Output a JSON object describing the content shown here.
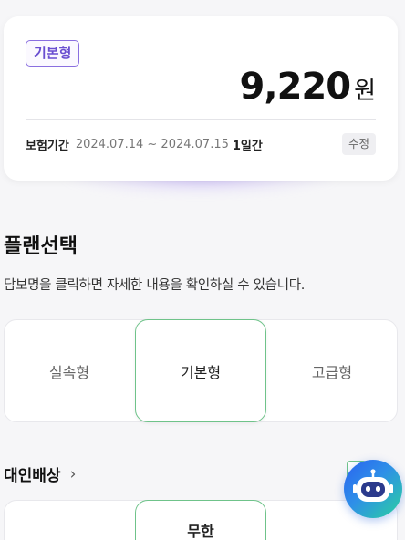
{
  "summary": {
    "plan_badge": "기본형",
    "price": "9,220",
    "currency": "원",
    "period_label": "보험기간",
    "period_range": "2024.07.14 ~ 2024.07.15",
    "period_days": "1일간",
    "edit_label": "수정"
  },
  "plan_section": {
    "title": "플랜선택",
    "description": "담보명을 클릭하면 자세한 내용을 확인하실 수 있습니다.",
    "options": [
      {
        "label": "실속형",
        "selected": false
      },
      {
        "label": "기본형",
        "selected": true
      },
      {
        "label": "고급형",
        "selected": false
      }
    ]
  },
  "coverage": {
    "title": "대인배상",
    "chevron": "›",
    "selected_value": "무한"
  },
  "chatbot": {
    "icon": "chatbot-robot-icon"
  },
  "colors": {
    "accent_purple": "#6a4fd0",
    "selected_green": "#6fc38a",
    "bot_blue": "#2a62f0",
    "bot_teal": "#2ad29f"
  }
}
